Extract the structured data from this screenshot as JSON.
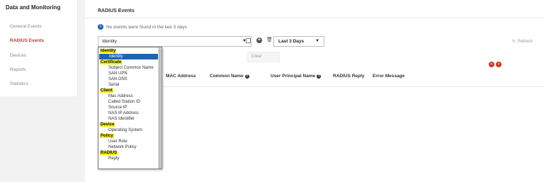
{
  "sidebar": {
    "title": "Data and Monitoring",
    "items": [
      {
        "label": "General Events"
      },
      {
        "label": "RADIUS Events"
      },
      {
        "label": "Devices"
      },
      {
        "label": "Reports"
      },
      {
        "label": "Statistics"
      }
    ],
    "active_index": 1
  },
  "main": {
    "title": "RADIUS Events",
    "info_text": "No events were found in the last 3 days",
    "filter_select": {
      "value": "Identity"
    },
    "days_select": {
      "value": "Last 3 Days"
    },
    "refresh_label": "Refresh",
    "clear_label": "Clear",
    "columns": [
      {
        "label": "MAC Address",
        "help": false
      },
      {
        "label": "Common Name",
        "help": true
      },
      {
        "label": "User Principal Name",
        "help": true
      },
      {
        "label": "RADIUS Reply",
        "help": false
      },
      {
        "label": "Error Message",
        "help": false
      }
    ]
  },
  "dropdown": {
    "groups": [
      {
        "label": "Identity",
        "options": [
          {
            "label": "Identity",
            "selected": true
          }
        ]
      },
      {
        "label": "Certificate",
        "options": [
          {
            "label": "Subject Common Name"
          },
          {
            "label": "SAN UPN"
          },
          {
            "label": "SAN DNS"
          },
          {
            "label": "Serial"
          }
        ]
      },
      {
        "label": "Client",
        "options": [
          {
            "label": "Mac Address"
          },
          {
            "label": "Called Station ID"
          },
          {
            "label": "Source IP"
          },
          {
            "label": "NAS IP Address"
          },
          {
            "label": "NAS Identifier"
          }
        ]
      },
      {
        "label": "Device",
        "options": [
          {
            "label": "Operating System"
          }
        ]
      },
      {
        "label": "Policy",
        "options": [
          {
            "label": "User Role"
          },
          {
            "label": "Network Policy"
          }
        ]
      },
      {
        "label": "RADIUS",
        "options": [
          {
            "label": "Reply"
          }
        ]
      }
    ]
  },
  "colors": {
    "accent": "#c0392b",
    "selected": "#1e64b4",
    "highlight": "#f5ec16",
    "nav_arrow": "#d9301f"
  },
  "icons": [
    "info-icon",
    "plus-icon",
    "trash-icon",
    "refresh-icon",
    "chevron-down-icon",
    "help-icon",
    "arrow-left-icon",
    "arrow-right-icon"
  ]
}
